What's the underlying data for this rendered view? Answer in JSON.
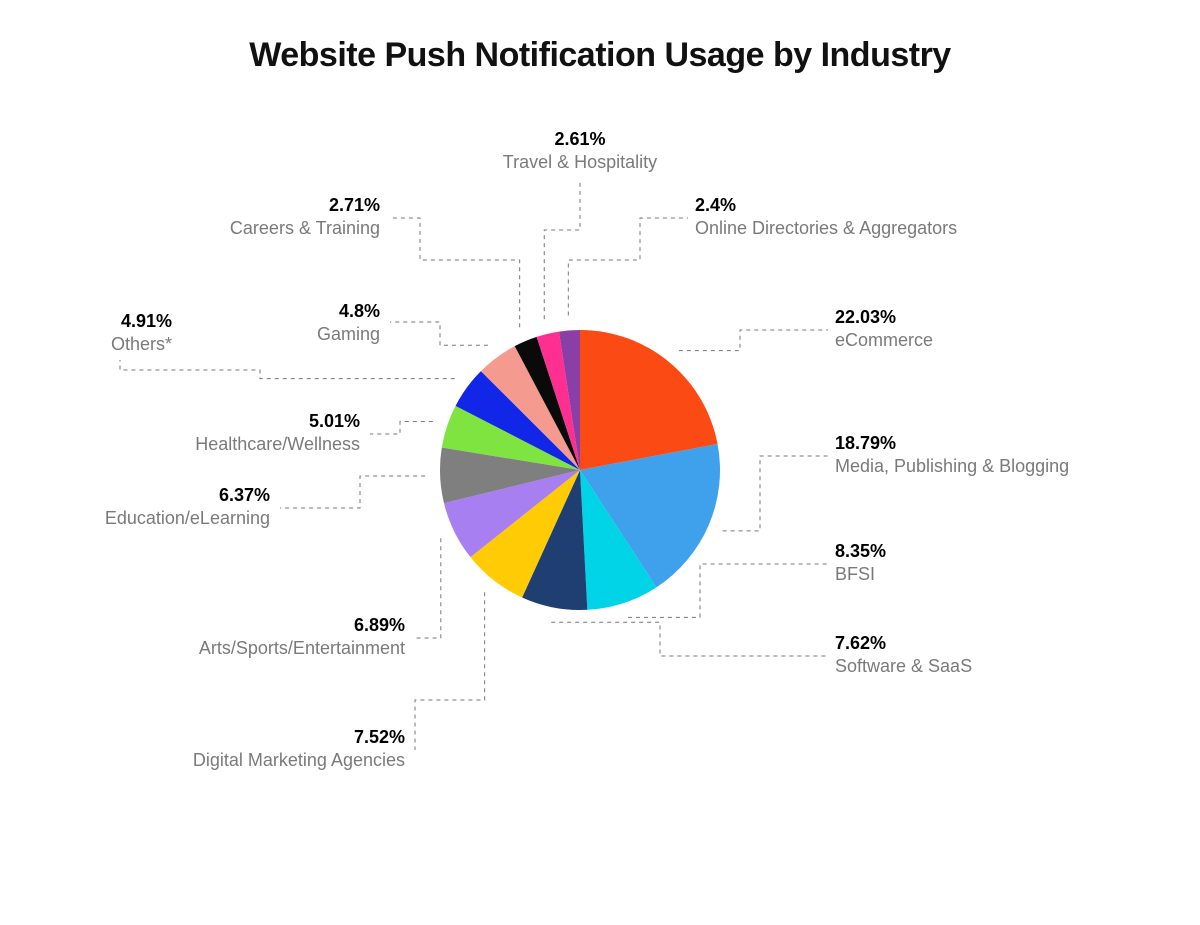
{
  "title": "Website Push Notification Usage by Industry",
  "chart_data": {
    "type": "pie",
    "title": "Website Push Notification Usage by Industry",
    "slices": [
      {
        "name": "eCommerce",
        "value": 22.03,
        "color": "#fb4a14"
      },
      {
        "name": "Media, Publishing & Blogging",
        "value": 18.79,
        "color": "#3fa0eb"
      },
      {
        "name": "BFSI",
        "value": 8.35,
        "color": "#00d4e6"
      },
      {
        "name": "Software & SaaS",
        "value": 7.62,
        "color": "#1f3f73"
      },
      {
        "name": "Digital Marketing Agencies",
        "value": 7.52,
        "color": "#ffcb05"
      },
      {
        "name": "Arts/Sports/Entertainment",
        "value": 6.89,
        "color": "#a77ff0"
      },
      {
        "name": "Education/eLearning",
        "value": 6.37,
        "color": "#7f7f7f"
      },
      {
        "name": "Healthcare/Wellness",
        "value": 5.01,
        "color": "#7fe340"
      },
      {
        "name": "Others*",
        "value": 4.91,
        "color": "#1226e8"
      },
      {
        "name": "Gaming",
        "value": 4.8,
        "color": "#f59a8f"
      },
      {
        "name": "Careers & Training",
        "value": 2.71,
        "color": "#0a0a0a"
      },
      {
        "name": "Travel & Hospitality",
        "value": 2.61,
        "color": "#ff2f92"
      },
      {
        "name": "Online Directories & Aggregators",
        "value": 2.4,
        "color": "#8a3fa6"
      }
    ]
  },
  "labels": {
    "ecommerce_pct": "22.03%",
    "ecommerce_name": "eCommerce",
    "media_pct": "18.79%",
    "media_name": "Media, Publishing & Blogging",
    "bfsi_pct": "8.35%",
    "bfsi_name": "BFSI",
    "saas_pct": "7.62%",
    "saas_name": "Software & SaaS",
    "dma_pct": "7.52%",
    "dma_name": "Digital Marketing Agencies",
    "arts_pct": "6.89%",
    "arts_name": "Arts/Sports/Entertainment",
    "edu_pct": "6.37%",
    "edu_name": "Education/eLearning",
    "health_pct": "5.01%",
    "health_name": "Healthcare/Wellness",
    "others_pct": "4.91%",
    "others_name": "Others*",
    "gaming_pct": "4.8%",
    "gaming_name": "Gaming",
    "careers_pct": "2.71%",
    "careers_name": "Careers & Training",
    "travel_pct": "2.61%",
    "travel_name": "Travel & Hospitality",
    "dirs_pct": "2.4%",
    "dirs_name": "Online Directories & Aggregators"
  }
}
